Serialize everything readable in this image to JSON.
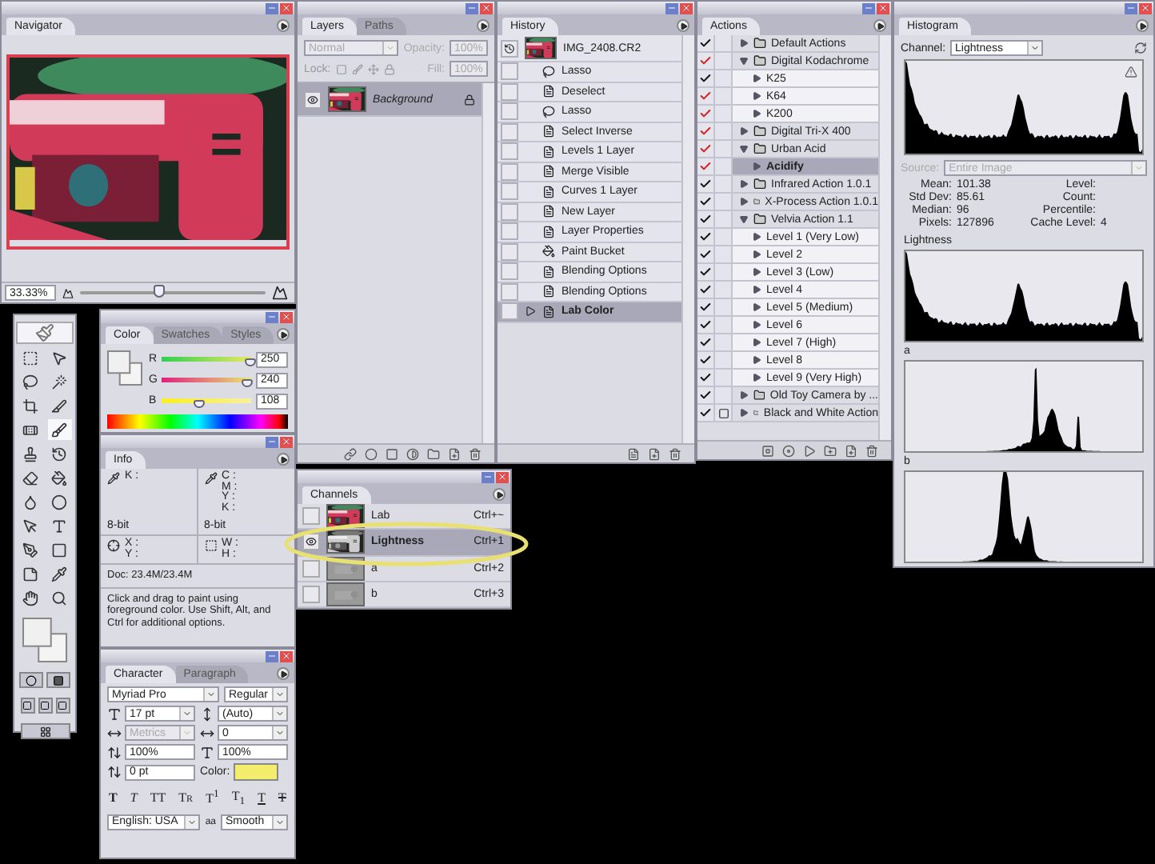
{
  "navigator": {
    "tabs": [
      {
        "label": "Navigator",
        "selected": true
      }
    ],
    "zoom": "33.33%",
    "level": 0.42
  },
  "color": {
    "tabs": [
      {
        "label": "Color",
        "selected": true
      },
      {
        "label": "Swatches",
        "selected": false
      },
      {
        "label": "Styles",
        "selected": false
      }
    ],
    "sliders": [
      {
        "name": "R",
        "value": "250",
        "level": 0.98
      },
      {
        "name": "G",
        "value": "240",
        "level": 0.94
      },
      {
        "name": "B",
        "value": "108",
        "level": 0.42
      }
    ]
  },
  "info": {
    "tabs": [
      {
        "label": "Info",
        "selected": true
      }
    ],
    "readouts_left": [
      "K :"
    ],
    "readouts_right": [
      "C :",
      "M :",
      "Y :",
      "K :"
    ],
    "bit_depth": [
      "8-bit",
      "8-bit"
    ],
    "position": [
      "X :",
      "Y :"
    ],
    "size": [
      "W :",
      "H :"
    ],
    "doc": "Doc: 23.4M/23.4M",
    "hint": "Click and drag to paint using foreground color.  Use Shift, Alt, and Ctrl for additional options."
  },
  "character": {
    "tabs": [
      {
        "label": "Character",
        "selected": true
      },
      {
        "label": "Paragraph",
        "selected": false
      }
    ],
    "font": "Myriad Pro",
    "style": "Regular",
    "size": "17 pt",
    "leading": "(Auto)",
    "kerning": "Metrics",
    "kerning_disabled": true,
    "tracking": "0",
    "vertical_scale": "100%",
    "horizontal_scale": "100%",
    "baseline": "0 pt",
    "color_label": "Color:",
    "style_buttons": [
      {
        "label": "T",
        "kind": "bold"
      },
      {
        "label": "T",
        "kind": "italic"
      },
      {
        "label": "TT",
        "kind": "caps"
      },
      {
        "label": "Tr",
        "kind": "smallcaps"
      },
      {
        "label": "T$^{1}$",
        "kind": "super"
      },
      {
        "label": "T$_{1}$",
        "kind": "sub"
      },
      {
        "label": "T",
        "kind": "underline"
      },
      {
        "label": "T",
        "kind": "strike"
      }
    ],
    "language": "English: USA",
    "antialias_label": "aa",
    "antialias": "Smooth"
  },
  "layers": {
    "tabs": [
      {
        "label": "Layers",
        "selected": true
      },
      {
        "label": "Paths",
        "selected": false
      }
    ],
    "blend_mode": "Normal",
    "opacity_label": "Opacity:",
    "opacity": "100%",
    "lock_label": "Lock:",
    "fill_label": "Fill:",
    "fill": "100%",
    "items": [
      {
        "name": "Background",
        "visible": true,
        "selected": true,
        "locked": true
      }
    ]
  },
  "history": {
    "tabs": [
      {
        "label": "History",
        "selected": true
      }
    ],
    "snapshot": "IMG_2408.CR2",
    "items": [
      {
        "name": "Lasso",
        "kind": "lasso",
        "selected": false
      },
      {
        "name": "Deselect",
        "kind": "command",
        "selected": false
      },
      {
        "name": "Lasso",
        "kind": "lasso",
        "selected": false
      },
      {
        "name": "Select Inverse",
        "kind": "command",
        "selected": false
      },
      {
        "name": "Levels 1 Layer",
        "kind": "command",
        "selected": false
      },
      {
        "name": "Merge Visible",
        "kind": "command",
        "selected": false
      },
      {
        "name": "Curves 1 Layer",
        "kind": "command",
        "selected": false
      },
      {
        "name": "New Layer",
        "kind": "command",
        "selected": false
      },
      {
        "name": "Layer Properties",
        "kind": "command",
        "selected": false
      },
      {
        "name": "Paint Bucket",
        "kind": "bucket",
        "selected": false
      },
      {
        "name": "Blending Options",
        "kind": "command",
        "selected": false
      },
      {
        "name": "Blending Options",
        "kind": "command",
        "selected": false
      },
      {
        "name": "Lab Color",
        "kind": "command",
        "selected": true
      }
    ]
  },
  "channels": {
    "tabs": [
      {
        "label": "Channels",
        "selected": true
      }
    ],
    "items": [
      {
        "name": "Lab",
        "shortcut": "Ctrl+~",
        "visible": false,
        "selected": false
      },
      {
        "name": "Lightness",
        "shortcut": "Ctrl+1",
        "visible": true,
        "selected": true
      },
      {
        "name": "a",
        "shortcut": "Ctrl+2",
        "visible": false,
        "selected": false
      },
      {
        "name": "b",
        "shortcut": "Ctrl+3",
        "visible": false,
        "selected": false
      }
    ]
  },
  "actions": {
    "tabs": [
      {
        "label": "Actions",
        "selected": true
      }
    ],
    "items": [
      {
        "name": "Default Actions",
        "kind": "set",
        "checked": true,
        "partial": false,
        "expanded": false,
        "selected": false,
        "dialog": false
      },
      {
        "name": "Digital Kodachrome",
        "kind": "set",
        "checked": true,
        "partial": true,
        "expanded": true,
        "selected": false,
        "dialog": false,
        "children": [
          {
            "name": "K25",
            "kind": "action",
            "checked": true,
            "partial": false,
            "expanded": false,
            "selected": false,
            "dialog": false
          },
          {
            "name": "K64",
            "kind": "action",
            "checked": true,
            "partial": true,
            "expanded": false,
            "selected": false,
            "dialog": false
          },
          {
            "name": "K200",
            "kind": "action",
            "checked": true,
            "partial": true,
            "expanded": false,
            "selected": false,
            "dialog": false
          }
        ]
      },
      {
        "name": "Digital Tri-X 400",
        "kind": "set",
        "checked": true,
        "partial": true,
        "expanded": false,
        "selected": false,
        "dialog": false
      },
      {
        "name": "Urban Acid",
        "kind": "set",
        "checked": true,
        "partial": true,
        "expanded": true,
        "selected": false,
        "dialog": false,
        "children": [
          {
            "name": "Acidify",
            "kind": "action",
            "checked": true,
            "partial": true,
            "expanded": false,
            "selected": true,
            "dialog": false
          }
        ]
      },
      {
        "name": "Infrared Action 1.0.1",
        "kind": "set",
        "checked": true,
        "partial": false,
        "expanded": false,
        "selected": false,
        "dialog": false
      },
      {
        "name": "X-Process Action 1.0.1",
        "kind": "set",
        "checked": true,
        "partial": false,
        "expanded": false,
        "selected": false,
        "dialog": false
      },
      {
        "name": "Velvia Action 1.1",
        "kind": "set",
        "checked": true,
        "partial": false,
        "expanded": true,
        "selected": false,
        "dialog": false,
        "children": [
          {
            "name": "Level 1 (Very Low)",
            "kind": "action",
            "checked": true,
            "partial": false,
            "expanded": false,
            "selected": false,
            "dialog": false
          },
          {
            "name": "Level 2",
            "kind": "action",
            "checked": true,
            "partial": false,
            "expanded": false,
            "selected": false,
            "dialog": false
          },
          {
            "name": "Level  3 (Low)",
            "kind": "action",
            "checked": true,
            "partial": false,
            "expanded": false,
            "selected": false,
            "dialog": false
          },
          {
            "name": "Level 4",
            "kind": "action",
            "checked": true,
            "partial": false,
            "expanded": false,
            "selected": false,
            "dialog": false
          },
          {
            "name": "Level 5 (Medium)",
            "kind": "action",
            "checked": true,
            "partial": false,
            "expanded": false,
            "selected": false,
            "dialog": false
          },
          {
            "name": "Level 6",
            "kind": "action",
            "checked": true,
            "partial": false,
            "expanded": false,
            "selected": false,
            "dialog": false
          },
          {
            "name": "Level 7 (High)",
            "kind": "action",
            "checked": true,
            "partial": false,
            "expanded": false,
            "selected": false,
            "dialog": false
          },
          {
            "name": "Level 8",
            "kind": "action",
            "checked": true,
            "partial": false,
            "expanded": false,
            "selected": false,
            "dialog": false
          },
          {
            "name": "Level 9 (Very High)",
            "kind": "action",
            "checked": true,
            "partial": false,
            "expanded": false,
            "selected": false,
            "dialog": false
          }
        ]
      },
      {
        "name": "Old Toy Camera by ...",
        "kind": "set",
        "checked": true,
        "partial": false,
        "expanded": false,
        "selected": false,
        "dialog": false
      },
      {
        "name": "Black and White Action",
        "kind": "set",
        "checked": true,
        "partial": false,
        "expanded": false,
        "selected": false,
        "dialog": true
      }
    ]
  },
  "histogram": {
    "tabs": [
      {
        "label": "Histogram",
        "selected": true
      }
    ],
    "channel_label": "Channel:",
    "channel": "Lightness",
    "source_label": "Source:",
    "source": "Entire Image",
    "source_disabled": true,
    "stats_left": [
      {
        "label": "Mean:",
        "value": "101.38"
      },
      {
        "label": "Std Dev:",
        "value": "85.61"
      },
      {
        "label": "Median:",
        "value": "96"
      },
      {
        "label": "Pixels:",
        "value": "127896"
      }
    ],
    "stats_right": [
      {
        "label": "Level:"
      },
      {
        "label": "Count:"
      },
      {
        "label": "Percentile:"
      },
      {
        "label": "Cache Level:",
        "value": "4"
      }
    ],
    "channel_graphs": [
      "Lightness",
      "a",
      "b"
    ]
  }
}
